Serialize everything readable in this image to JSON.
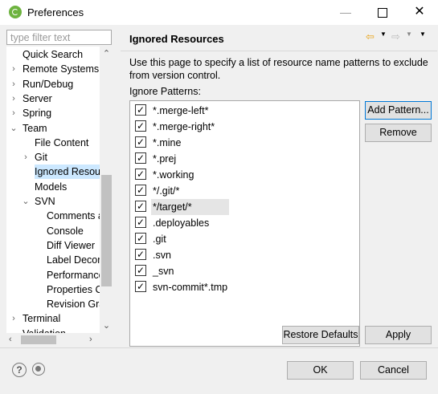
{
  "window": {
    "title": "Preferences",
    "min": "—",
    "close": "✕"
  },
  "filter": {
    "placeholder": "type filter text"
  },
  "tree": [
    {
      "label": "Quick Search",
      "indent": 1,
      "chevron": ""
    },
    {
      "label": "Remote Systems",
      "indent": 1,
      "chevron": "›"
    },
    {
      "label": "Run/Debug",
      "indent": 1,
      "chevron": "›"
    },
    {
      "label": "Server",
      "indent": 1,
      "chevron": "›"
    },
    {
      "label": "Spring",
      "indent": 1,
      "chevron": "›"
    },
    {
      "label": "Team",
      "indent": 1,
      "chevron": "⌄"
    },
    {
      "label": "File Content",
      "indent": 2,
      "chevron": ""
    },
    {
      "label": "Git",
      "indent": 2,
      "chevron": "›"
    },
    {
      "label": "Ignored Resour",
      "indent": 2,
      "chevron": "",
      "selected": true
    },
    {
      "label": "Models",
      "indent": 2,
      "chevron": ""
    },
    {
      "label": "SVN",
      "indent": 2,
      "chevron": "⌄"
    },
    {
      "label": "Comments a",
      "indent": 3,
      "chevron": ""
    },
    {
      "label": "Console",
      "indent": 3,
      "chevron": ""
    },
    {
      "label": "Diff Viewer",
      "indent": 3,
      "chevron": ""
    },
    {
      "label": "Label Decora",
      "indent": 3,
      "chevron": ""
    },
    {
      "label": "Performance",
      "indent": 3,
      "chevron": ""
    },
    {
      "label": "Properties C",
      "indent": 3,
      "chevron": ""
    },
    {
      "label": "Revision Gra",
      "indent": 3,
      "chevron": ""
    },
    {
      "label": "Terminal",
      "indent": 1,
      "chevron": "›"
    },
    {
      "label": "Validation",
      "indent": 1,
      "chevron": ""
    }
  ],
  "page": {
    "title": "Ignored Resources",
    "description": "Use this page to specify a list of resource name patterns to exclude from version control.",
    "patterns_label": "Ignore Patterns:"
  },
  "patterns": [
    {
      "label": "*.merge-left*",
      "checked": true
    },
    {
      "label": "*.merge-right*",
      "checked": true
    },
    {
      "label": "*.mine",
      "checked": true
    },
    {
      "label": "*.prej",
      "checked": true
    },
    {
      "label": "*.working",
      "checked": true
    },
    {
      "label": "*/.git/*",
      "checked": true
    },
    {
      "label": "*/target/*",
      "checked": true,
      "selected": true
    },
    {
      "label": ".deployables",
      "checked": true
    },
    {
      "label": ".git",
      "checked": true
    },
    {
      "label": ".svn",
      "checked": true
    },
    {
      "label": "_svn",
      "checked": true
    },
    {
      "label": "svn-commit*.tmp",
      "checked": true
    }
  ],
  "buttons": {
    "add": "Add Pattern...",
    "remove": "Remove",
    "restore": "Restore Defaults",
    "apply": "Apply",
    "ok": "OK",
    "cancel": "Cancel"
  },
  "icons": {
    "app": "spring-icon",
    "help": "?",
    "check": "✓",
    "nav_back": "⇦",
    "nav_fwd": "⇨",
    "dropdown": "▼",
    "scroll_up": "⌃",
    "scroll_down": "⌄",
    "scroll_left": "‹",
    "scroll_right": "›"
  },
  "colors": {
    "selection": "#cce8ff",
    "accent": "#0078d7",
    "spring": "#6db33f"
  }
}
